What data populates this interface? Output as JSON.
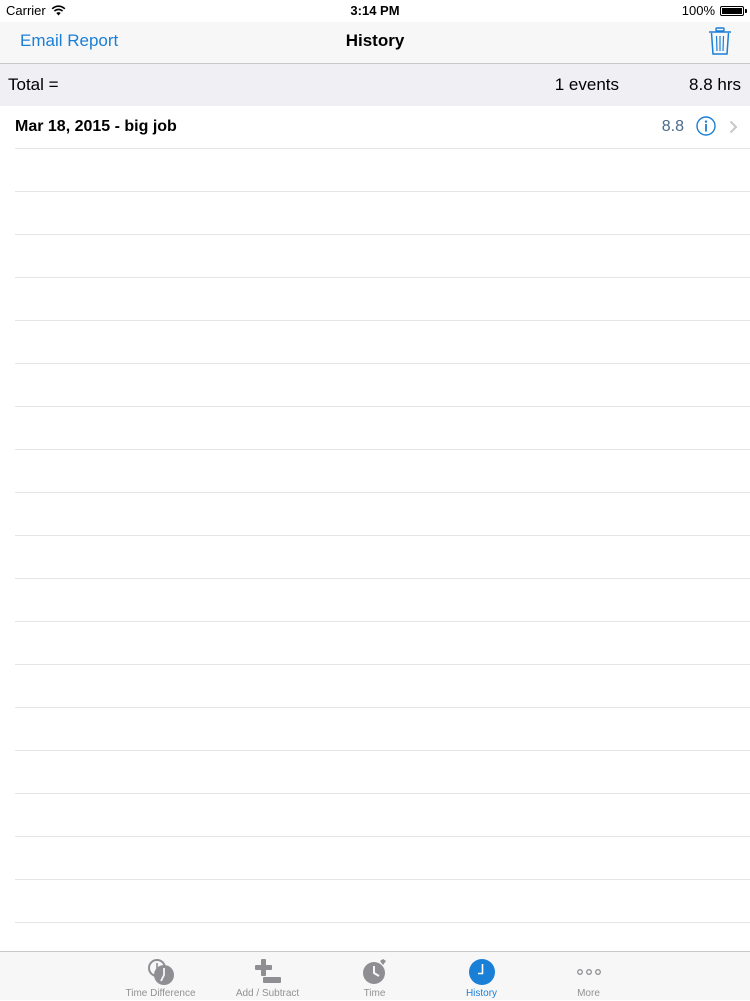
{
  "status_bar": {
    "carrier": "Carrier",
    "time": "3:14 PM",
    "battery": "100%",
    "battery_level": 1.0
  },
  "nav": {
    "email_label": "Email Report",
    "title": "History",
    "trash_icon": "trash-icon"
  },
  "total": {
    "label": "Total =",
    "events": "1 events",
    "hours": "8.8 hrs"
  },
  "events": [
    {
      "name": "Mar 18, 2015 - big job",
      "value": "8.8"
    }
  ],
  "tabs": [
    {
      "label": "Time Difference",
      "icon": "time-difference-icon",
      "active": false
    },
    {
      "label": "Add / Subtract",
      "icon": "add-subtract-icon",
      "active": false
    },
    {
      "label": "Time",
      "icon": "time-icon",
      "active": false
    },
    {
      "label": "History",
      "icon": "history-icon",
      "active": true
    },
    {
      "label": "More",
      "icon": "more-icon",
      "active": false
    }
  ],
  "colors": {
    "accent": "#1a7fd6",
    "value_text": "#4a6a8c",
    "inactive_tab": "#929292"
  }
}
